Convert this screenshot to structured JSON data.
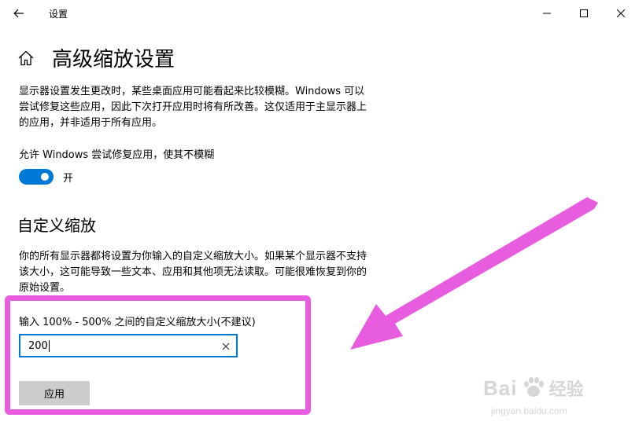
{
  "window": {
    "title": "设置",
    "controls": [
      "minimize-icon",
      "maximize-icon",
      "close-icon"
    ]
  },
  "page": {
    "title": "高级缩放设置",
    "description": "显示器设置发生更改时，某些桌面应用可能看起来比较模糊。Windows 可以尝试修复这些应用，因此下次打开应用时将有所改善。这仅适用于主显示器上的应用，并非适用于所有应用。"
  },
  "fix_apps": {
    "label": "允许 Windows 尝试修复应用，使其不模糊",
    "enabled": true,
    "state_text": "开"
  },
  "custom_scaling": {
    "title": "自定义缩放",
    "description": "你的所有显示器都将设置为你输入的自定义缩放大小。如果某个显示器不支持该大小，这可能导致一些文本、应用和其他项无法读取。可能很难恢复到你的原始设置。",
    "input_label": "输入 100% - 500% 之间的自定义缩放大小(不建议)",
    "input_value": "200",
    "apply_label": "应用"
  },
  "colors": {
    "accent": "#0078d7",
    "annotation": "#e85ce0",
    "button_bg": "#cccccc"
  },
  "watermark": {
    "brand": "Bai",
    "brand_suffix": "经验",
    "url": "jingyan.baidu.com"
  }
}
